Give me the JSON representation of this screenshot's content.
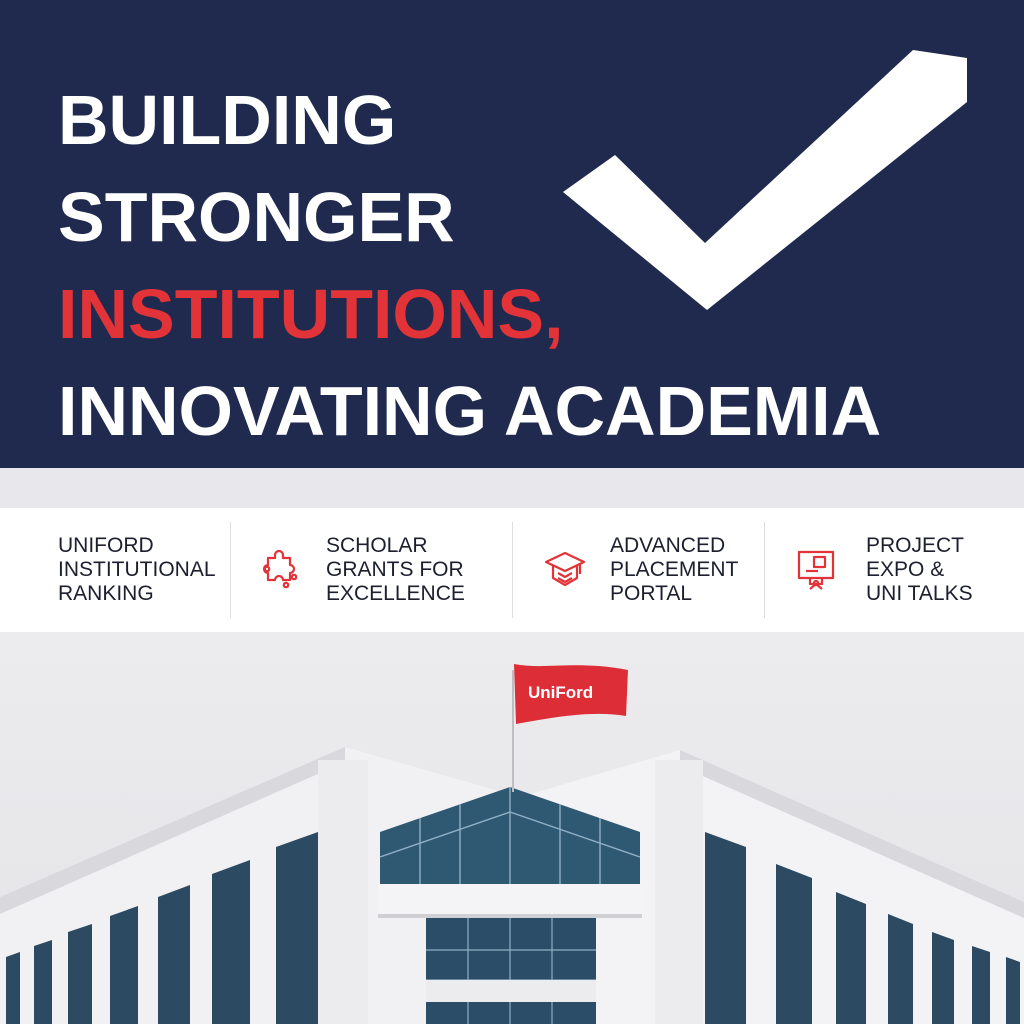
{
  "hero": {
    "headline_lines": [
      "BUILDING",
      "STRONGER",
      "INSTITUTIONS,",
      "INNOVATING ACADEMIA"
    ]
  },
  "features": [
    {
      "label": "UNIFORD\nINSTITUTIONAL\nRANKING",
      "icon": "none"
    },
    {
      "label": "SCHOLAR\nGRANTS FOR\nEXCELLENCE",
      "icon": "puzzle-icon"
    },
    {
      "label": "ADVANCED\nPLACEMENT\nPORTAL",
      "icon": "graduation-cap-icon"
    },
    {
      "label": "PROJECT\nEXPO &\nUNI TALKS",
      "icon": "presentation-board-icon"
    }
  ],
  "photo": {
    "flag_text": "UniFord"
  },
  "colors": {
    "navy": "#1f2a4e",
    "accent_red": "#e23338",
    "white": "#ffffff"
  }
}
